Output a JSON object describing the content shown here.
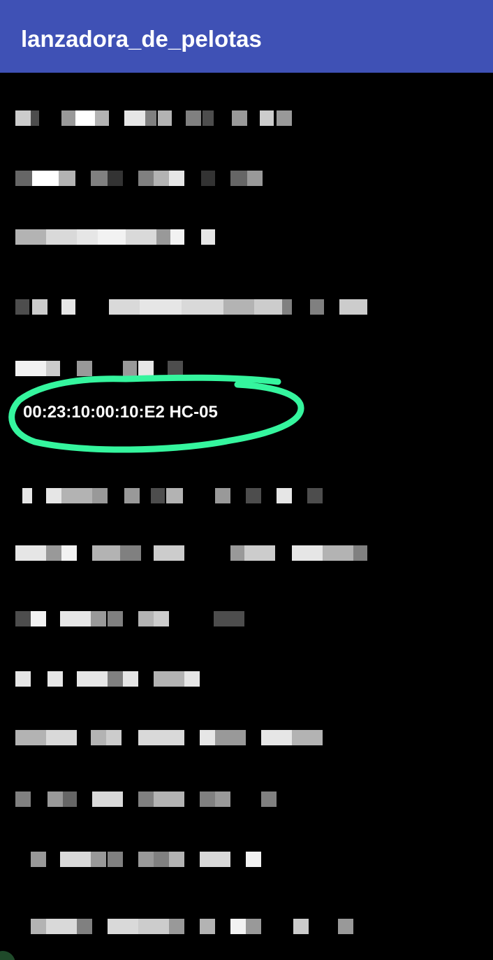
{
  "app_bar": {
    "title": "lanzadora_de_pelotas",
    "color": "#3f51b5"
  },
  "device_list": {
    "highlighted_device": {
      "label": "00:23:10:00:10:E2 HC-05",
      "highlight_color": "#35f59e"
    },
    "obscured_rows": [
      {
        "id": "row-1"
      },
      {
        "id": "row-2"
      },
      {
        "id": "row-3"
      },
      {
        "id": "row-4"
      },
      {
        "id": "row-5"
      },
      {
        "id": "row-7"
      },
      {
        "id": "row-8"
      },
      {
        "id": "row-9"
      },
      {
        "id": "row-10"
      },
      {
        "id": "row-11"
      },
      {
        "id": "row-12"
      },
      {
        "id": "row-13"
      },
      {
        "id": "row-14"
      }
    ]
  }
}
